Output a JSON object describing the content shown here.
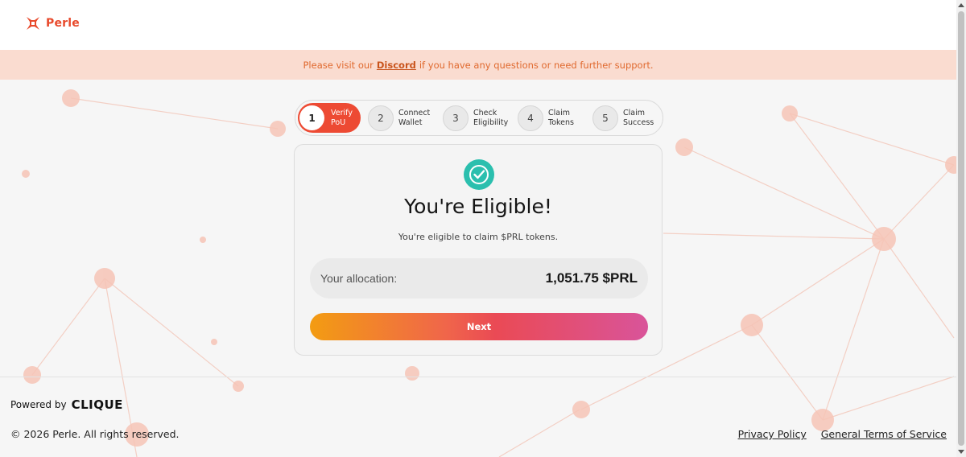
{
  "header": {
    "brand": "Perle"
  },
  "banner": {
    "prefix": "Please visit our",
    "link": "Discord",
    "suffix": "if you have any questions or need further support."
  },
  "steps": [
    {
      "num": "1",
      "label": "Verify\nPoU",
      "active": true
    },
    {
      "num": "2",
      "label": "Connect\nWallet",
      "active": false
    },
    {
      "num": "3",
      "label": "Check\nEligibility",
      "active": false
    },
    {
      "num": "4",
      "label": "Claim\nTokens",
      "active": false
    },
    {
      "num": "5",
      "label": "Claim\nSuccess",
      "active": false
    }
  ],
  "card": {
    "title": "You're Eligible!",
    "subtitle": "You're eligible to claim $PRL tokens.",
    "allocation_label": "Your allocation:",
    "allocation_value": "1,051.75 $PRL",
    "next_label": "Next",
    "icon": "check-circle-icon"
  },
  "footer": {
    "powered_by": "Powered by",
    "powered_brand": "CLIQUE",
    "copyright": "© 2026 Perle. All rights reserved.",
    "privacy": "Privacy Policy",
    "terms": "General Terms of Service"
  },
  "colors": {
    "brand": "#e8492b",
    "accent_teal": "#2bbfae",
    "banner_bg": "#fadcd0"
  }
}
